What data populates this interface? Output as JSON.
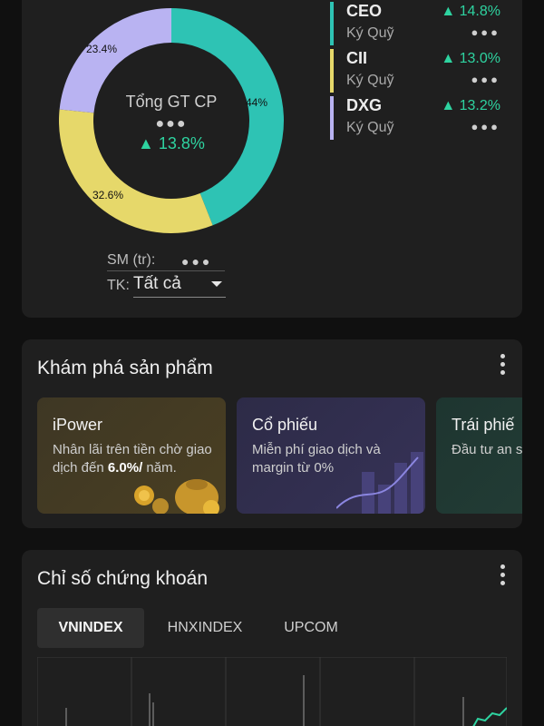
{
  "portfolio": {
    "center_title": "Tổng GT CP",
    "center_masked": "●●●",
    "center_change": "13.8%",
    "donut": [
      {
        "label": "44%",
        "value": 44,
        "color": "#2ec3b4"
      },
      {
        "label": "32.6%",
        "value": 32.6,
        "color": "#e6d86a"
      },
      {
        "label": "23.4%",
        "value": 23.4,
        "color": "#b9b3f2"
      }
    ],
    "sm_label": "SM (tr):",
    "sm_value": "●●●",
    "tk_label": "TK:",
    "tk_value": "Tất cả",
    "stocks": [
      {
        "code": "CEO",
        "sub": "Ký Quỹ",
        "change": "14.8%",
        "masked": "●●●",
        "color": "#2ec3b4"
      },
      {
        "code": "CII",
        "sub": "Ký Quỹ",
        "change": "13.0%",
        "masked": "●●●",
        "color": "#e6d86a"
      },
      {
        "code": "DXG",
        "sub": "Ký Quỹ",
        "change": "13.2%",
        "masked": "●●●",
        "color": "#b9b3f2"
      }
    ]
  },
  "products": {
    "title": "Khám phá sản phẩm",
    "items": [
      {
        "title": "iPower",
        "desc_pre": "Nhân lãi trên tiền chờ giao dịch đến ",
        "desc_bold": "6.0%/",
        "desc_post": " năm."
      },
      {
        "title": "Cổ phiếu",
        "desc": "Miễn phí giao dịch và margin từ 0%"
      },
      {
        "title": "Trái phiế",
        "desc": "Đầu tư an sống an nh"
      }
    ]
  },
  "index": {
    "title": "Chỉ số chứng khoán",
    "tabs": [
      "VNINDEX",
      "HNXINDEX",
      "UPCOM"
    ],
    "active_tab": "VNINDEX"
  },
  "colors": {
    "accent_up": "#2ed3a0",
    "card_bg": "#1f1f1f",
    "page_bg": "#101010"
  }
}
